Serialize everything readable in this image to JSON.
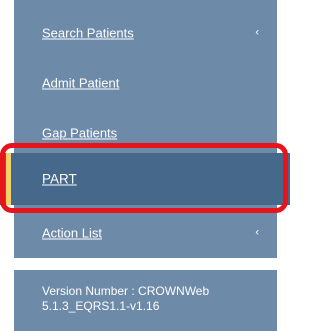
{
  "sidebar": {
    "items": [
      {
        "label": "Search Patients",
        "has_submenu": true,
        "chevron": "‹"
      },
      {
        "label": "Admit Patient",
        "has_submenu": false
      },
      {
        "label": "Gap Patients",
        "has_submenu": false
      },
      {
        "label": "PART",
        "has_submenu": false,
        "active": true
      },
      {
        "label": "Action List",
        "has_submenu": true,
        "chevron": "‹"
      }
    ]
  },
  "version": {
    "line1": "Version Number : CROWNWeb",
    "line2": "5.1.3_EQRS1.1-v1.16"
  },
  "colors": {
    "sidebar_bg": "#6d8aa8",
    "active_bg": "#46688b",
    "active_accent": "#f3d16a",
    "highlight_border": "#e8141c"
  },
  "icons": {
    "submenu_indicator": "chevron-left-icon"
  }
}
